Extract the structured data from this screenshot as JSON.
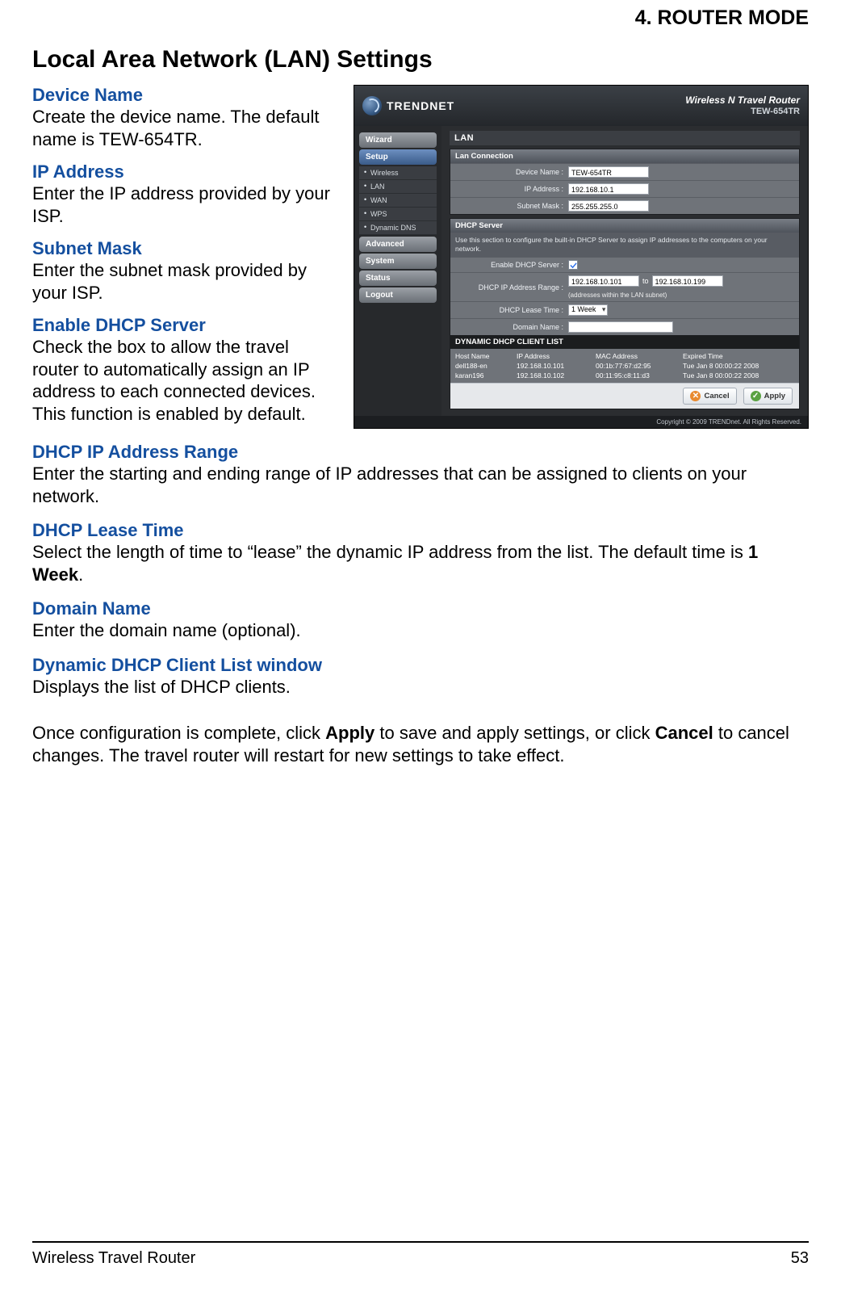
{
  "chapter": "4.  ROUTER MODE",
  "section_title": "Local Area Network (LAN) Settings",
  "defs": {
    "device_name": {
      "h": "Device Name",
      "p": "Create the device name. The default name is TEW-654TR."
    },
    "ip": {
      "h": "IP Address",
      "p": "Enter the IP address provided by your ISP."
    },
    "subnet": {
      "h": "Subnet Mask",
      "p": "Enter the subnet mask provided by your ISP."
    },
    "dhcp_en": {
      "h": "Enable DHCP Server",
      "p": "Check the box to allow the travel router to automatically assign an IP address to each connected devices. This function is enabled by default."
    },
    "range": {
      "h": "DHCP IP Address Range",
      "p": "Enter the starting and ending range of IP addresses that can be assigned to clients on your network."
    },
    "lease": {
      "h": "DHCP Lease Time",
      "p_pre": "Select the length of time to “lease” the dynamic IP address from the list. The default time is ",
      "p_bold": "1 Week",
      "p_post": "."
    },
    "domain": {
      "h": "Domain Name",
      "p": "Enter the domain name (optional)."
    },
    "list": {
      "h": "Dynamic DHCP Client List window",
      "p": "Displays the list of DHCP clients."
    }
  },
  "closing_pre": "Once configuration is complete, click ",
  "closing_b1": "Apply",
  "closing_mid": " to save and apply settings, or click ",
  "closing_b2": "Cancel",
  "closing_post": " to cancel changes. The travel router will restart for new settings to take effect.",
  "footer": {
    "left": "Wireless Travel Router",
    "right": "53"
  },
  "ui": {
    "brand": "TRENDNET",
    "prod_line1": "Wireless N Travel Router",
    "prod_line2": "TEW-654TR",
    "nav": {
      "wizard": "Wizard",
      "setup": "Setup",
      "sub": {
        "wireless": "Wireless",
        "lan": "LAN",
        "wan": "WAN",
        "wps": "WPS",
        "ddns": "Dynamic DNS"
      },
      "advanced": "Advanced",
      "system": "System",
      "status": "Status",
      "logout": "Logout"
    },
    "page": "LAN",
    "lan_conn": "Lan Connection",
    "labels": {
      "dev": "Device Name :",
      "ip": "IP Address :",
      "mask": "Subnet Mask :",
      "dhcp_en": "Enable DHCP Server :",
      "range": "DHCP IP Address Range :",
      "lease": "DHCP Lease Time :",
      "domain": "Domain Name :"
    },
    "values": {
      "dev": "TEW-654TR",
      "ip": "192.168.10.1",
      "mask": "255.255.255.0",
      "range_from": "192.168.10.101",
      "range_to": "192.168.10.199",
      "range_to_label": "to",
      "range_note": "(addresses within the LAN subnet)",
      "lease_sel": "1 Week",
      "domain": ""
    },
    "dhcp_h": "DHCP Server",
    "dhcp_sub": "Use this section to configure the built-in DHCP Server to assign IP addresses to the computers on your network.",
    "client_h": "DYNAMIC DHCP CLIENT LIST",
    "tbl_head": {
      "host": "Host Name",
      "ip": "IP Address",
      "mac": "MAC Address",
      "exp": "Expired Time"
    },
    "tbl_rows": [
      {
        "host": "dell188-en",
        "ip": "192.168.10.101",
        "mac": "00:1b:77:67:d2:95",
        "exp": "Tue Jan 8 00:00:22 2008"
      },
      {
        "host": "karan196",
        "ip": "192.168.10.102",
        "mac": "00:11:95:c8:11:d3",
        "exp": "Tue Jan 8 00:00:22 2008"
      }
    ],
    "btn_cancel": "Cancel",
    "btn_apply": "Apply",
    "copyright": "Copyright © 2009 TRENDnet. All Rights Reserved."
  }
}
